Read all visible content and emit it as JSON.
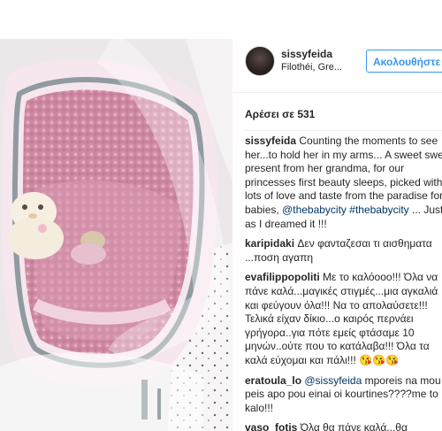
{
  "post": {
    "username": "sissyfeida",
    "location": "Filothéi, Gre...",
    "follow_label": "Ακολουθήστε",
    "likes_text": "Αρέσει σε 531"
  },
  "caption": {
    "username": "sissyfeida",
    "text_1": "Counting the moments to see her...to hold her in my arms... A sweet sweet present from her grandma, for our princesses first beauty sleeps, picked with lots of love and taste from the paradise for babies,",
    "mention": "@thebabycity",
    "hashtag": "#thebabycity",
    "text_2": "... Just as I dreamed it !!!"
  },
  "comments": [
    {
      "username": "karipidaki",
      "text": "Δεν φανταζεσαι τι αισθηματα ...ποση αγαπη"
    },
    {
      "username": "evafilippopoliti",
      "text": "Με το καλόοοο!!! Όλα να πάνε καλά...μαγικές στιγμές...μια αγκαλιά και φεύγουν όλα!!! Να το απολαύσετε!!! Τελικά είχαν δίκιο...ο καιρός περνάει γρήγορα..για πότε εμείς φτάσαμε 10 μηνών..ούτε που το κατάλαβα!!! Όλα τα καλά εύχομαι και πάλι!!! 😘😘😘"
    },
    {
      "username": "eratoula_lo",
      "mention": "@sissyfeida",
      "text": "mporeis na mou peis apo pou einai oi kourtines????me to kalo!!!"
    },
    {
      "username": "vaso_fotis",
      "text": "Όλα θα πάνε καλά...θα"
    }
  ],
  "icons": {
    "avatar": "profile-avatar"
  },
  "colors": {
    "accent": "#3897f0",
    "mention": "#003569",
    "text": "#262626"
  }
}
